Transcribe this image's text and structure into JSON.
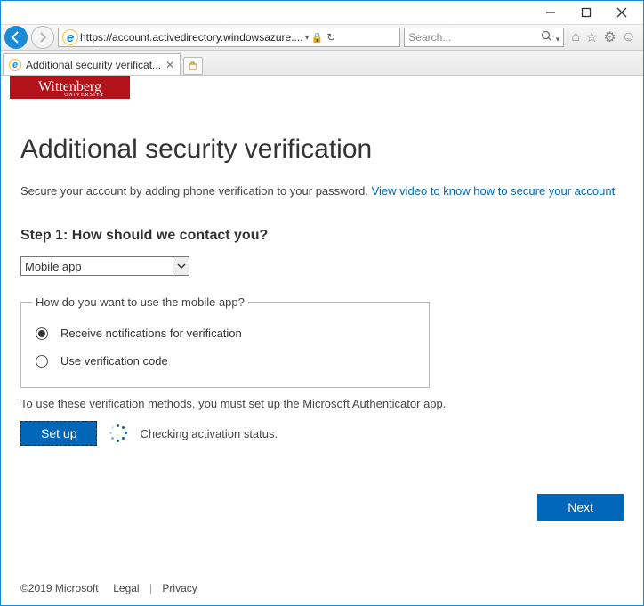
{
  "window": {
    "url_display": "https://account.activedirectory.windowsazure....",
    "search_placeholder": "Search...",
    "tab_title": "Additional security verificat..."
  },
  "logo": {
    "text": "Wittenberg",
    "sub": "UNIVERSITY"
  },
  "page": {
    "heading": "Additional security verification",
    "subtitle_text": "Secure your account by adding phone verification to your password. ",
    "subtitle_link": "View video to know how to secure your account",
    "step_label": "Step 1: How should we contact you?",
    "contact_method": "Mobile app",
    "fieldset_legend": "How do you want to use the mobile app?",
    "radio_options": [
      "Receive notifications for verification",
      "Use verification code"
    ],
    "instruction": "To use these verification methods, you must set up the Microsoft Authenticator app.",
    "setup_label": "Set up",
    "status_text": "Checking activation status.",
    "next_label": "Next"
  },
  "footer": {
    "copyright": "©2019 Microsoft",
    "legal": "Legal",
    "privacy": "Privacy"
  }
}
